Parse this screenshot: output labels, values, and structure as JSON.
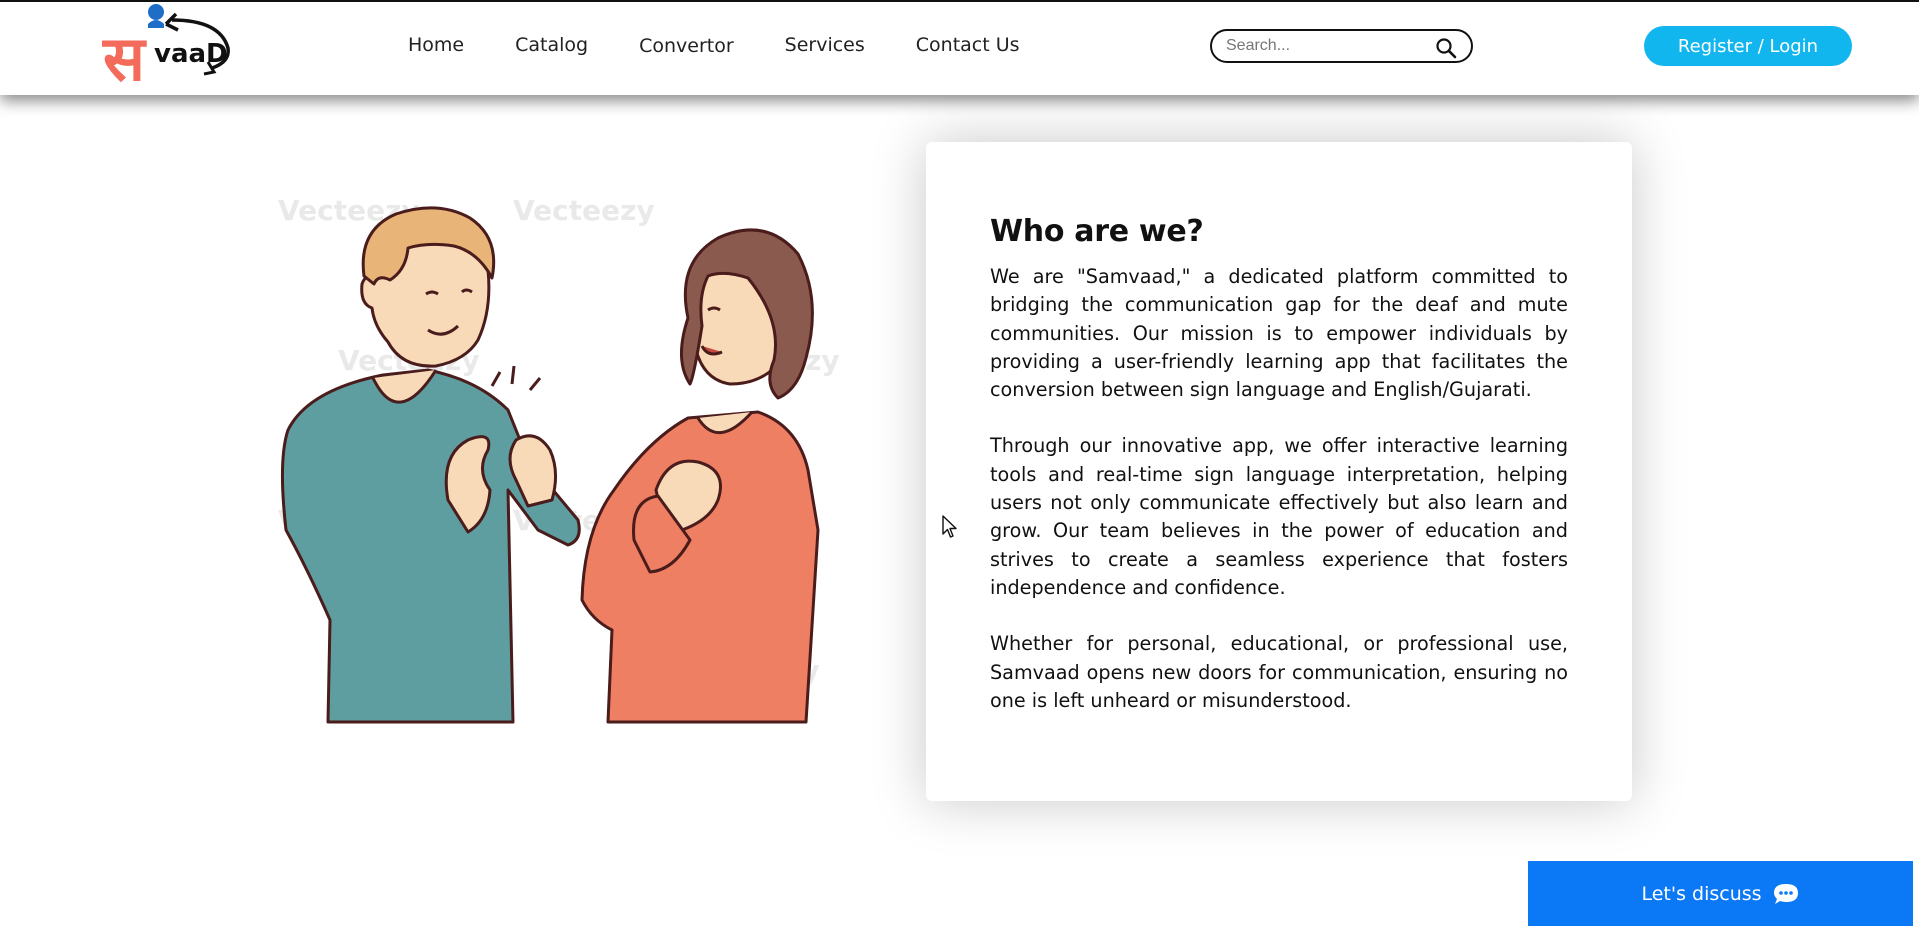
{
  "brand": {
    "logo_letter": "स",
    "logo_text": "vaaD"
  },
  "nav": {
    "items": [
      {
        "label": "Home"
      },
      {
        "label": "Catalog"
      },
      {
        "label": "Convertor"
      },
      {
        "label": "Services"
      },
      {
        "label": "Contact Us"
      }
    ]
  },
  "search": {
    "placeholder": "Search..."
  },
  "auth": {
    "register_label": "Register / Login"
  },
  "illustration": {
    "watermark": "Vecteezy"
  },
  "about": {
    "title": "Who are we?",
    "paragraphs": [
      "We are \"Samvaad,\" a dedicated platform committed to bridging the communication gap for the deaf and mute communities. Our mission is to empower individuals by providing a user-friendly learning app that facilitates the conversion between sign language and English/Gujarati.",
      "Through our innovative app, we offer interactive learning tools and real-time sign language interpretation, helping users not only communicate effectively but also learn and grow. Our team believes in the power of education and strives to create a seamless experience that fosters independence and confidence.",
      "Whether for personal, educational, or professional use, Samvaad opens new doors for communication, ensuring no one is left unheard or misunderstood."
    ]
  },
  "chat_widget": {
    "label": "Let's discuss"
  },
  "colors": {
    "accent": "#12b6ef",
    "chat_button": "#0b78f5",
    "logo_red": "#f26b5b",
    "shirt_teal": "#5f9ea0",
    "shirt_orange": "#ef7f62"
  }
}
